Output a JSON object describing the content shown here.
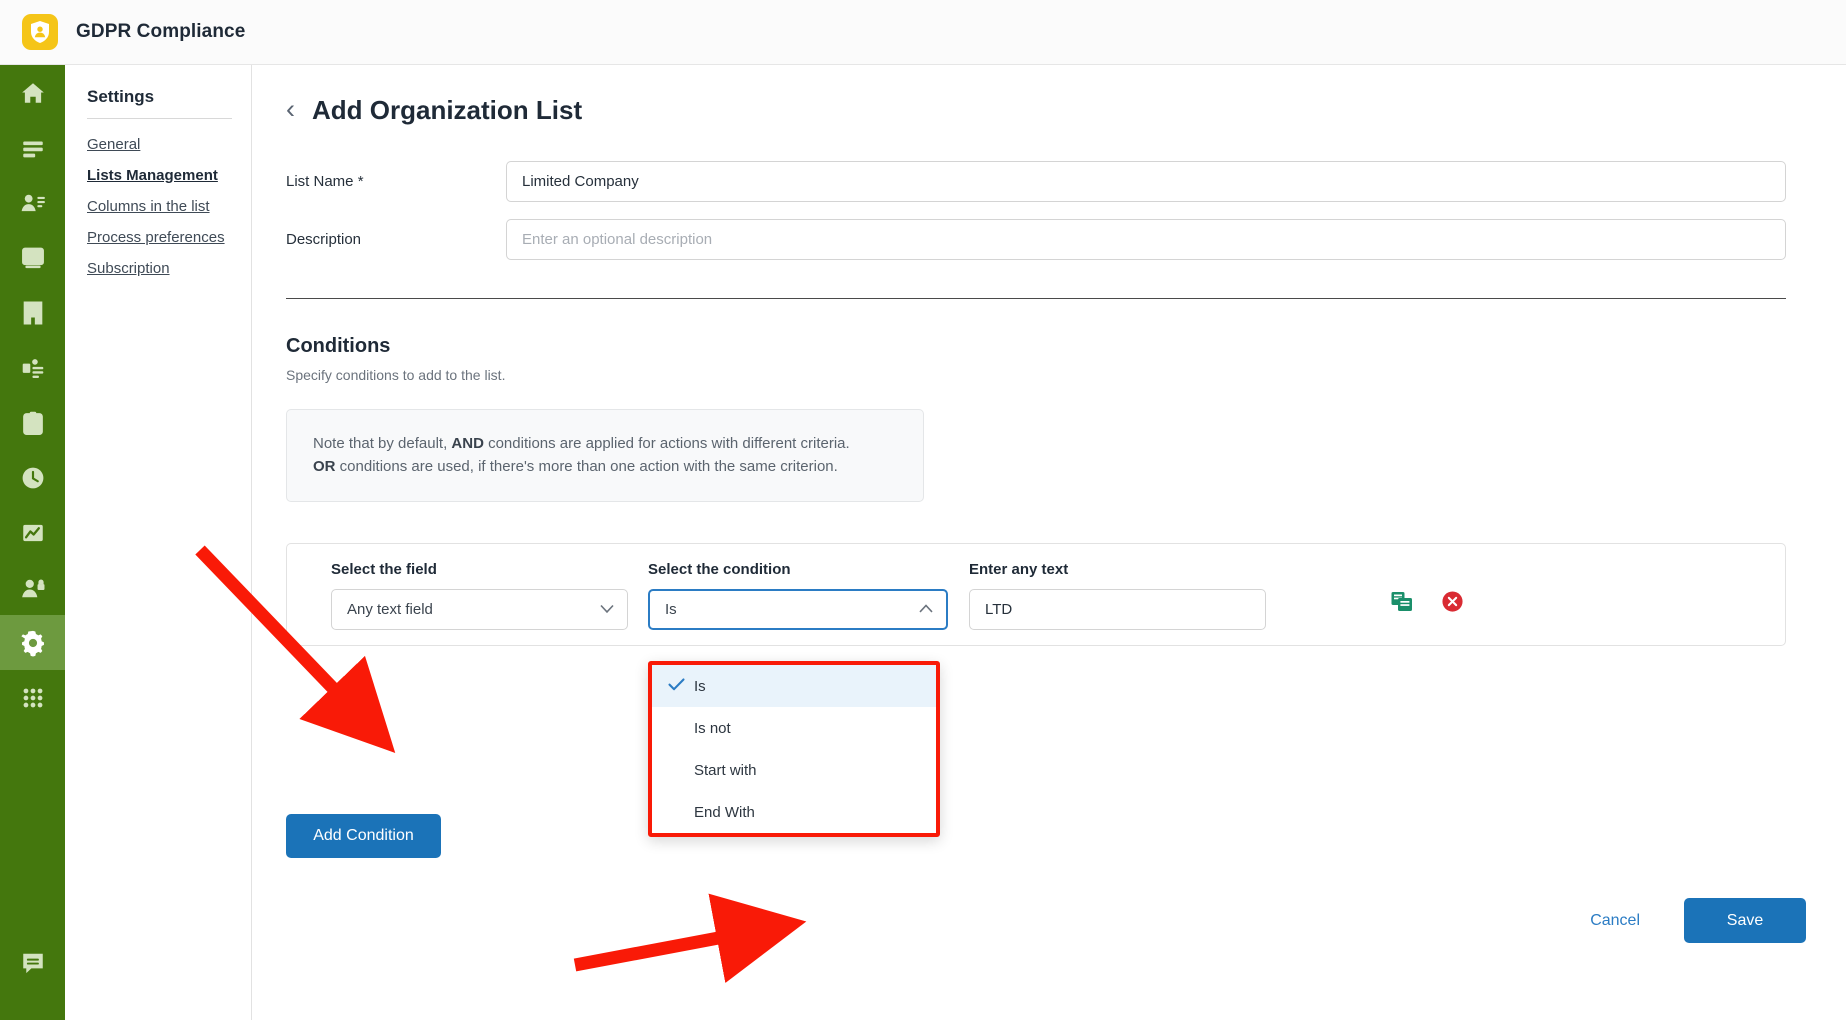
{
  "header": {
    "app_title": "GDPR Compliance",
    "logo_icon": "shield-person-icon"
  },
  "rail": {
    "items": [
      {
        "icon": "home-icon",
        "active": false
      },
      {
        "icon": "list-lines-icon",
        "active": false
      },
      {
        "icon": "person-lines-icon",
        "active": false
      },
      {
        "icon": "database-icon",
        "active": false
      },
      {
        "icon": "building-icon",
        "active": false
      },
      {
        "icon": "flow-chart-icon",
        "active": false
      },
      {
        "icon": "clipboard-person-icon",
        "active": false
      },
      {
        "icon": "clock-icon",
        "active": false
      },
      {
        "icon": "chart-image-icon",
        "active": false
      },
      {
        "icon": "person-lock-icon",
        "active": false
      },
      {
        "icon": "gear-icon",
        "active": true
      },
      {
        "icon": "grid-apps-icon",
        "active": false
      }
    ],
    "bottom_icon": "chat-bubble-icon"
  },
  "subnav": {
    "title": "Settings",
    "items": [
      {
        "label": "General",
        "current": false
      },
      {
        "label": "Lists Management",
        "current": true
      },
      {
        "label": "Columns in the list",
        "current": false
      },
      {
        "label": "Process preferences",
        "current": false
      },
      {
        "label": "Subscription",
        "current": false
      }
    ]
  },
  "page": {
    "back_icon": "chevron-left-icon",
    "title": "Add Organization List"
  },
  "form": {
    "list_name_label": "List Name *",
    "list_name_value": "Limited Company",
    "description_label": "Description",
    "description_value": "",
    "description_placeholder": "Enter an optional description"
  },
  "conditions": {
    "title": "Conditions",
    "subtitle": "Specify conditions to add to the list.",
    "note": {
      "line1_pre": "Note that by default, ",
      "line1_bold": "AND",
      "line1_post": " conditions are applied for actions with different criteria.",
      "line2_bold": "OR",
      "line2_post": " conditions are used, if there's more than one action with the same criterion."
    },
    "row": {
      "field_label": "Select the field",
      "field_value": "Any text field",
      "field_caret_icon": "chevron-down-icon",
      "condition_label": "Select the condition",
      "condition_value": "Is",
      "condition_caret_icon": "chevron-up-icon",
      "text_label": "Enter any text",
      "text_value": "LTD",
      "duplicate_icon": "duplicate-icon",
      "delete_icon": "delete-circle-icon",
      "duplicate_color": "#1a8f6a",
      "delete_color": "#d92b33"
    },
    "dropdown": {
      "check_icon": "check-icon",
      "options": [
        {
          "label": "Is",
          "selected": true
        },
        {
          "label": "Is not",
          "selected": false
        },
        {
          "label": "Start with",
          "selected": false
        },
        {
          "label": "End With",
          "selected": false
        }
      ]
    },
    "add_condition_label": "Add Condition"
  },
  "footer": {
    "cancel_label": "Cancel",
    "save_label": "Save"
  },
  "colors": {
    "brand_yellow": "#f5c518",
    "rail_green": "#44770d",
    "rail_active_green": "#6d9a3f",
    "primary_blue": "#1b73b8",
    "focus_blue": "#2b7cc4",
    "annotation_red": "#f91a07"
  }
}
